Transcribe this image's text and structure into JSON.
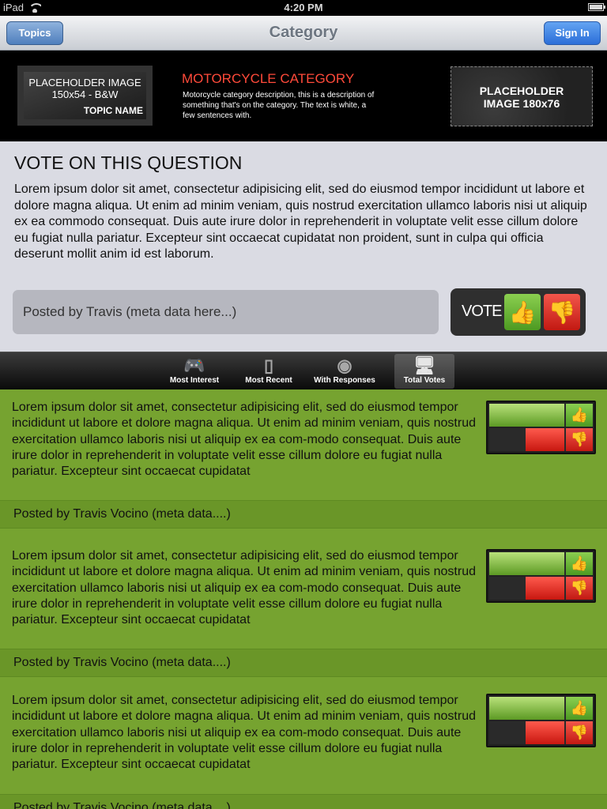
{
  "statusbar": {
    "carrier": "iPad",
    "time": "4:20 PM"
  },
  "navbar": {
    "title": "Category",
    "left_button": "Topics",
    "right_button": "Sign In"
  },
  "category": {
    "left_placeholder": {
      "line1": "PLACEHOLDER IMAGE",
      "line2": "150x54  -  B&W",
      "topic": "TOPIC NAME"
    },
    "title": "MOTORCYCLE CATEGORY",
    "description": "Motorcycle category description, this is a description of something that's on the category. The text is white, a few sentences with.",
    "right_placeholder": {
      "line1": "PLACEHOLDER",
      "line2": "IMAGE 180x76"
    }
  },
  "question": {
    "title": "VOTE ON THIS QUESTION",
    "text": "Lorem ipsum dolor sit amet, consectetur adipisicing elit, sed do eiusmod tempor incididunt ut labore et dolore magna aliqua. Ut enim ad minim veniam, quis nostrud exercitation ullamco laboris nisi ut aliquip ex ea commodo consequat. Duis aute irure dolor in reprehenderit in voluptate velit esse cillum dolore eu fugiat nulla pariatur. Excepteur sint occaecat cupidatat non proident, sunt in culpa qui officia deserunt mollit anim id est laborum.",
    "posted_by": "Posted by Travis (meta data here...)",
    "vote_label": "VOTE"
  },
  "tabs": [
    {
      "label": "Most Interest",
      "icon": "gamepad-icon"
    },
    {
      "label": "Most Recent",
      "icon": "ipod-icon"
    },
    {
      "label": "With Responses",
      "icon": "disc-icon"
    },
    {
      "label": "Total Votes",
      "icon": "monitor-icon",
      "active": true
    }
  ],
  "items": [
    {
      "text": "Lorem ipsum dolor sit amet, consectetur adipisicing elit, sed do eiusmod tempor incididunt ut labore et dolore magna aliqua. Ut enim ad minim veniam, quis nostrud exercitation ullamco laboris nisi ut aliquip ex ea com-modo consequat. Duis aute irure dolor in reprehenderit in voluptate velit esse cillum dolore eu fugiat nulla pariatur. Excepteur sint occaecat cupidatat",
      "meta": "Posted by Travis Vocino (meta data....)",
      "up_fraction": 1.0,
      "down_fraction": 0.52
    },
    {
      "text": "Lorem ipsum dolor sit amet, consectetur adipisicing elit, sed do eiusmod tempor incididunt ut labore et dolore magna aliqua. Ut enim ad minim veniam, quis nostrud exercitation ullamco laboris nisi ut aliquip ex ea com-modo consequat. Duis aute irure dolor in reprehenderit in voluptate velit esse cillum dolore eu fugiat nulla pariatur. Excepteur sint occaecat cupidatat",
      "meta": "Posted by Travis Vocino (meta data....)",
      "up_fraction": 1.0,
      "down_fraction": 0.52
    },
    {
      "text": "Lorem ipsum dolor sit amet, consectetur adipisicing elit, sed do eiusmod tempor incididunt ut labore et dolore magna aliqua. Ut enim ad minim veniam, quis nostrud exercitation ullamco laboris nisi ut aliquip ex ea com-modo consequat. Duis aute irure dolor in reprehenderit in voluptate velit esse cillum dolore eu fugiat nulla pariatur. Excepteur sint occaecat cupidatat",
      "meta": "Posted by Travis Vocino (meta data....)",
      "up_fraction": 1.0,
      "down_fraction": 0.52
    }
  ],
  "colors": {
    "list_bg": "#76a330",
    "accent_red": "#ff4a3a",
    "button_blue": "#2b6ed8"
  }
}
